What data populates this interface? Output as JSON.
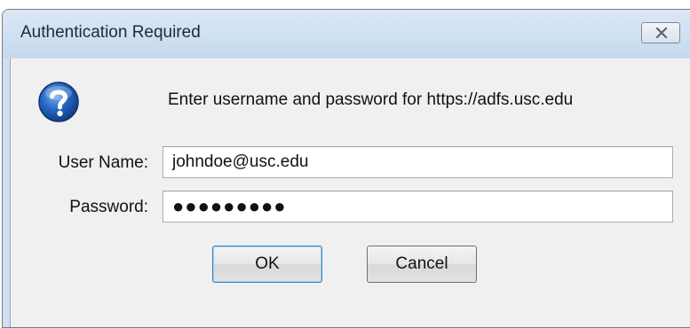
{
  "dialog": {
    "title": "Authentication Required",
    "prompt": "Enter username and password for https://adfs.usc.edu",
    "username_label": "User Name:",
    "username_value": "johndoe@usc.edu",
    "password_label": "Password:",
    "password_value": "●●●●●●●●●",
    "ok_label": "OK",
    "cancel_label": "Cancel"
  },
  "icons": {
    "help": "question-icon",
    "close": "close-icon"
  },
  "colors": {
    "titlebar": "#cfe0f2",
    "client": "#f0f0f0",
    "help_icon": "#1f5fb0",
    "default_button_border": "#3c7fb1"
  }
}
